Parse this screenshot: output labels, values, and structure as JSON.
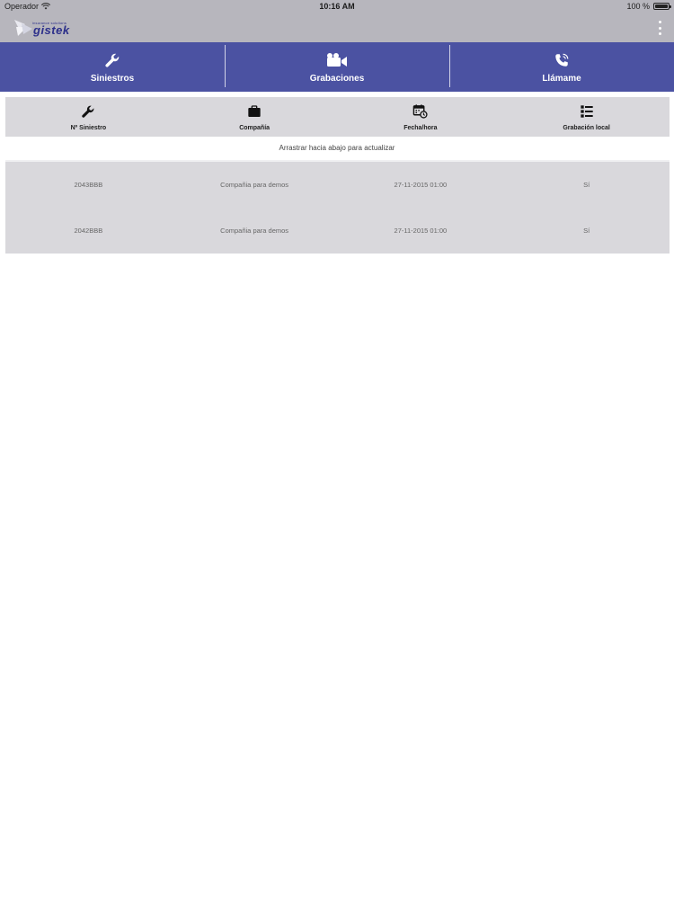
{
  "status_bar": {
    "carrier": "Operador",
    "time": "10:16 AM",
    "battery": "100 %"
  },
  "header": {
    "logo_tagline": "insurance solutions",
    "logo_brand": "gistek"
  },
  "nav": {
    "tabs": [
      {
        "label": "Siniestros",
        "icon": "wrench-icon"
      },
      {
        "label": "Grabaciones",
        "icon": "video-camera-icon"
      },
      {
        "label": "Llámame",
        "icon": "phone-icon"
      }
    ]
  },
  "table": {
    "columns": [
      {
        "label": "Nº Siniestro",
        "icon": "wrench-icon"
      },
      {
        "label": "Compañía",
        "icon": "briefcase-icon"
      },
      {
        "label": "Fecha/hora",
        "icon": "calendar-clock-icon"
      },
      {
        "label": "Grabación local",
        "icon": "list-icon"
      }
    ],
    "pull_hint": "Arrastrar hacia abajo para actualizar",
    "rows": [
      [
        "2043BBB",
        "Compañia para demos",
        "27-11-2015 01:00",
        "Sí"
      ],
      [
        "2042BBB",
        "Compañia para demos",
        "27-11-2015 01:00",
        "Sí"
      ]
    ]
  },
  "colors": {
    "nav_bg": "#4b52a2",
    "status_bg": "#b7b6bd",
    "table_bg": "#d9d8dc",
    "logo_color": "#2c2f8a"
  }
}
